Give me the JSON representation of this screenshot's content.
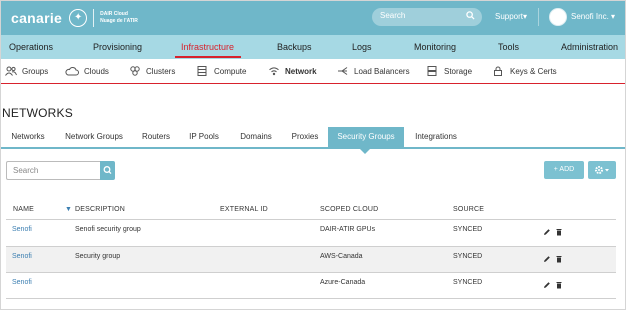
{
  "header": {
    "brand": "canarie",
    "brand_sub_1": "DAIR Cloud",
    "brand_sub_2": "Nuage de l'ATIR",
    "search_placeholder": "Search",
    "support_label": "Support",
    "user_label": "Senofi Inc."
  },
  "main_nav": {
    "items": [
      {
        "label": "Operations"
      },
      {
        "label": "Provisioning"
      },
      {
        "label": "Infrastructure"
      },
      {
        "label": "Backups"
      },
      {
        "label": "Logs"
      },
      {
        "label": "Monitoring"
      },
      {
        "label": "Tools"
      },
      {
        "label": "Administration"
      }
    ],
    "active": "Infrastructure"
  },
  "sub_nav": {
    "items": [
      {
        "label": "Groups",
        "icon": "groups-icon"
      },
      {
        "label": "Clouds",
        "icon": "cloud-icon"
      },
      {
        "label": "Clusters",
        "icon": "clusters-icon"
      },
      {
        "label": "Compute",
        "icon": "compute-icon"
      },
      {
        "label": "Network",
        "icon": "network-icon"
      },
      {
        "label": "Load Balancers",
        "icon": "load-balancer-icon"
      },
      {
        "label": "Storage",
        "icon": "storage-icon"
      },
      {
        "label": "Keys & Certs",
        "icon": "lock-icon"
      }
    ],
    "active": "Network"
  },
  "page_title": "NETWORKS",
  "tabs": {
    "items": [
      {
        "label": "Networks"
      },
      {
        "label": "Network Groups"
      },
      {
        "label": "Routers"
      },
      {
        "label": "IP Pools"
      },
      {
        "label": "Domains"
      },
      {
        "label": "Proxies"
      },
      {
        "label": "Security Groups"
      },
      {
        "label": "Integrations"
      }
    ],
    "active": "Security Groups"
  },
  "search": {
    "placeholder": "Search"
  },
  "actions": {
    "add_label": "+ ADD"
  },
  "table": {
    "columns": [
      "NAME",
      "DESCRIPTION",
      "EXTERNAL ID",
      "SCOPED CLOUD",
      "SOURCE"
    ],
    "rows": [
      {
        "name": "Senofi",
        "description": "Senofi security group",
        "external_id": "",
        "scoped_cloud": "DAIR-ATIR GPUs",
        "source": "SYNCED"
      },
      {
        "name": "Senofi",
        "description": "Security group",
        "external_id": "",
        "scoped_cloud": "AWS-Canada",
        "source": "SYNCED"
      },
      {
        "name": "Senofi",
        "description": "",
        "external_id": "",
        "scoped_cloud": "Azure-Canada",
        "source": "SYNCED"
      }
    ]
  },
  "colors": {
    "header": "#6fb7c9",
    "main_nav": "#a6d9e4",
    "accent_red": "#d8222d",
    "link": "#3c7fb1"
  }
}
